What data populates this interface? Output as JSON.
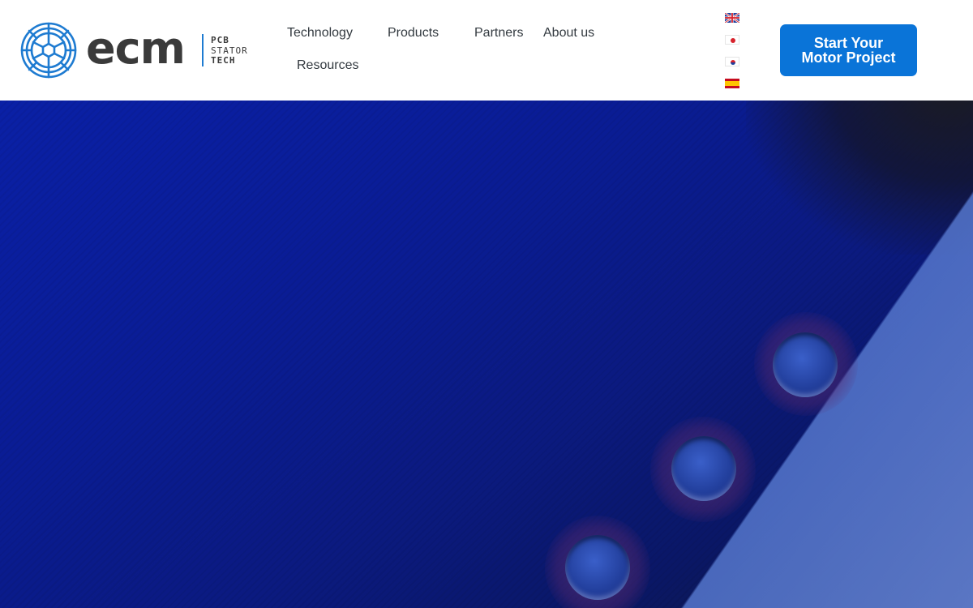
{
  "logo": {
    "wordmark": "ecm",
    "tagline": [
      "PCB",
      "STATOR",
      "TECH"
    ],
    "brand_color": "#1e7bd1"
  },
  "nav": {
    "items": [
      {
        "label": "Technology"
      },
      {
        "label": "Products"
      },
      {
        "label": "Partners"
      },
      {
        "label": "About us"
      },
      {
        "label": "Resources"
      }
    ]
  },
  "languages": [
    {
      "icon": "uk-flag-icon"
    },
    {
      "icon": "japan-flag-icon"
    },
    {
      "icon": "korea-flag-icon"
    },
    {
      "icon": "spain-flag-icon"
    }
  ],
  "cta": {
    "line1": "Start Your",
    "line2": "Motor Project",
    "color": "#0a74d8"
  },
  "colors": {
    "hero_blue": "#0a1c94",
    "text": "#333a40"
  }
}
